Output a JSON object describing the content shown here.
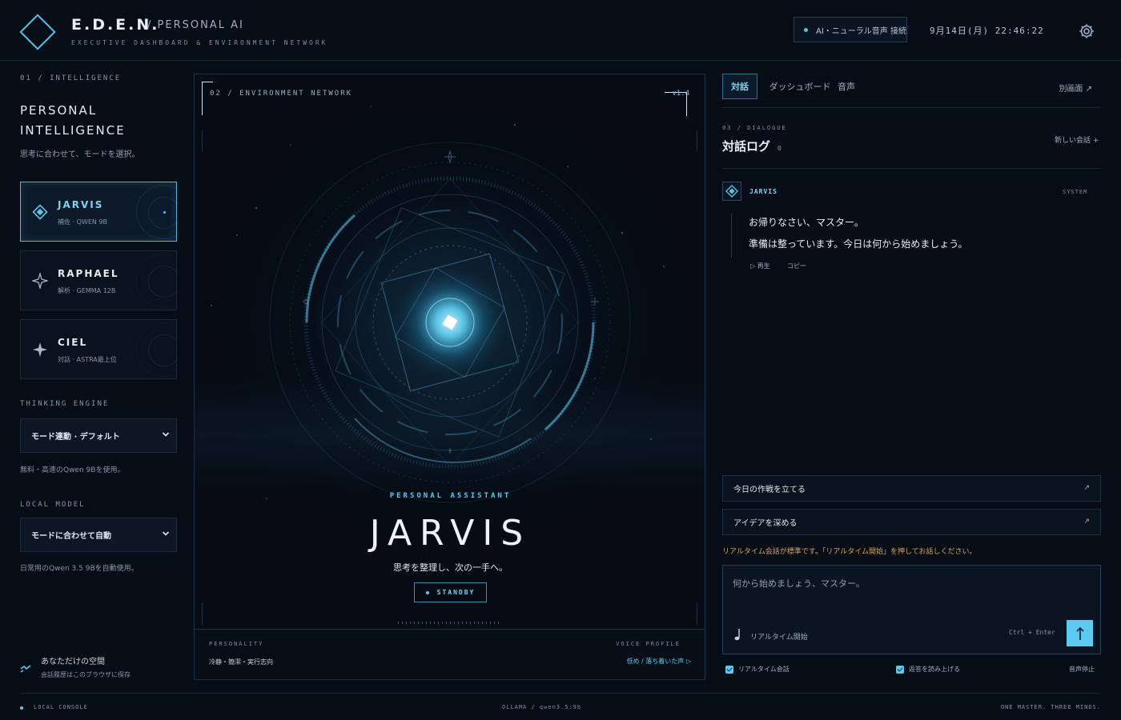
{
  "header": {
    "brand": "E.D.E.N.",
    "brand_sub": "/ PERSONAL AI",
    "tagline": "EXECUTIVE DASHBOARD & ENVIRONMENT NETWORK",
    "status": "AI・ニューラル音声 接続",
    "datetime": "9月14日(月) 22:46:22",
    "settings_icon": "gear-icon"
  },
  "left": {
    "section_label": "01 / INTELLIGENCE",
    "title_line1": "PERSONAL",
    "title_line2": "INTELLIGENCE",
    "description": "思考に合わせて、モードを選択。",
    "personas": [
      {
        "name": "JARVIS",
        "meta": "補佐 · QWEN 9B",
        "icon": "diamond-icon",
        "active": true
      },
      {
        "name": "RAPHAEL",
        "meta": "解析 · GEMMA 12B",
        "icon": "star-outline-icon",
        "active": false
      },
      {
        "name": "CIEL",
        "meta": "対話 · ASTRA最上位",
        "icon": "star-filled-icon",
        "active": false
      }
    ],
    "engine_label": "THINKING ENGINE",
    "engine_value": "モード連動 · デフォルト",
    "engine_note": "無料・高速のQwen 9Bを使用。",
    "model_label": "LOCAL MODEL",
    "model_value": "モードに合わせて自動",
    "model_note": "日常用のQwen 3.5 9Bを自動使用。",
    "space_title": "あなただけの空間",
    "space_sub": "会話履歴はこのブラウザに保存"
  },
  "center": {
    "section_label": "02 / ENVIRONMENT NETWORK",
    "version": "v1.4",
    "assistant_label": "PERSONAL ASSISTANT",
    "assistant_name": "JARVIS",
    "tagline": "思考を整理し、次の一手へ。",
    "status": "STANDBY",
    "personality_label": "PERSONALITY",
    "personality_value": "冷静・簡潔・実行志向",
    "voice_label": "VOICE PROFILE",
    "voice_value": "低め / 落ち着いた声 ▷"
  },
  "right": {
    "tabs": [
      "対話",
      "ダッシュボード",
      "音声"
    ],
    "popout": "別画面 ↗",
    "dialogue_label": "03 / DIALOGUE",
    "dialogue_title": "対話ログ",
    "dialogue_count": "0",
    "new_chat": "新しい会話 +",
    "message": {
      "author": "JARVIS",
      "role": "SYSTEM",
      "line1": "お帰りなさい、マスター。",
      "line2": "準備は整っています。今日は何から始めましょう。",
      "play": "▷ 再生",
      "copy": "コピー"
    },
    "quick_actions": [
      "今日の作戦を立てる",
      "アイデアを深める"
    ],
    "quick_arrow": "↗",
    "realtime_hint": "リアルタイム会話が標準です。「リアルタイム開始」を押してお話しください。",
    "input_placeholder": "何から始めましょう、マスター。",
    "realtime_start": "リアルタイム開始",
    "shortcut": "Ctrl + Enter",
    "options": [
      "リアルタイム会話",
      "返答を読み上げる"
    ],
    "stop_voice": "音声停止"
  },
  "footer": {
    "left": "LOCAL CONSOLE",
    "middle": "OLLAMA / qwen3.5:9b",
    "right": "ONE MASTER. THREE MINDS."
  },
  "colors": {
    "accent": "#4fc3e8",
    "background": "#070d17",
    "warning": "#d9a45a"
  }
}
